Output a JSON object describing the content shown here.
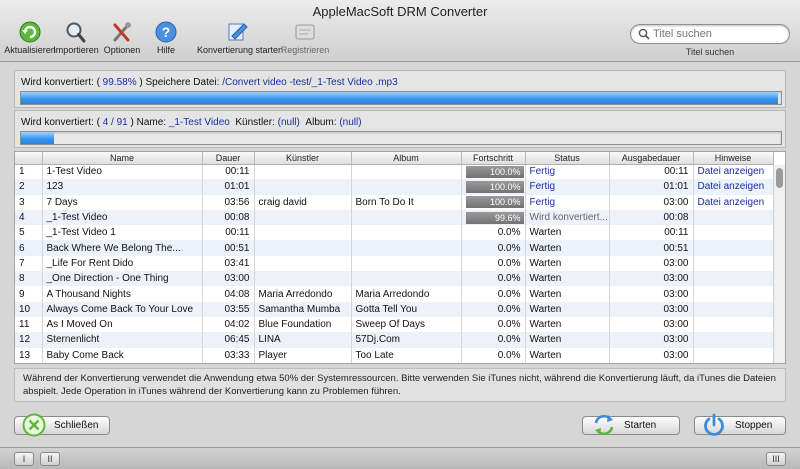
{
  "window": {
    "title": "AppleMacSoft DRM Converter"
  },
  "toolbar": {
    "items": [
      {
        "label": "Aktualisieren",
        "icon": "refresh-icon"
      },
      {
        "label": "Importieren",
        "icon": "magnifier-icon"
      },
      {
        "label": "Optionen",
        "icon": "tools-icon"
      },
      {
        "label": "Hilfe",
        "icon": "help-icon"
      },
      {
        "label": "Konvertierung starten",
        "icon": "convert-icon"
      },
      {
        "label": "Registrieren",
        "icon": "register-icon"
      }
    ],
    "search": {
      "placeholder": "Titel suchen",
      "label": "Titel suchen"
    }
  },
  "progress_file": {
    "prefix": "Wird konvertiert: (",
    "percent_text": " 99.58% ",
    "middle": ") Speichere Datei: ",
    "path": "/Convert video -test/_1-Test Video .mp3",
    "fill": 0.9958
  },
  "progress_total": {
    "prefix": "Wird konvertiert: ( ",
    "count_text": "4 / 91",
    "after_count": " ) Name: ",
    "name": "_1-Test Video",
    "artist_label": "Künstler: ",
    "artist": "(null)",
    "album_label": "Album: ",
    "album": "(null)",
    "fill": 0.044
  },
  "table": {
    "columns": [
      "Name",
      "Dauer",
      "Künstler",
      "Album",
      "Fortschritt",
      "Status",
      "Ausgabedauer",
      "Hinweise"
    ],
    "rows": [
      {
        "num": "1",
        "name": "1-Test Video",
        "duration": "00:11",
        "artist": "",
        "album": "",
        "progress": "100.0%",
        "status": "Fertig",
        "output": "00:11",
        "note": "Datei anzeigen"
      },
      {
        "num": "2",
        "name": "123",
        "duration": "01:01",
        "artist": "",
        "album": "",
        "progress": "100.0%",
        "status": "Fertig",
        "output": "01:01",
        "note": "Datei anzeigen"
      },
      {
        "num": "3",
        "name": "7 Days",
        "duration": "03:56",
        "artist": "craig david",
        "album": "Born To Do It",
        "progress": "100.0%",
        "status": "Fertig",
        "output": "03:00",
        "note": "Datei anzeigen"
      },
      {
        "num": "4",
        "name": "_1-Test Video",
        "duration": "00:08",
        "artist": "",
        "album": "",
        "progress": "99.6%",
        "status": "Wird konvertiert...",
        "output": "00:08",
        "note": ""
      },
      {
        "num": "5",
        "name": "_1-Test Video 1",
        "duration": "00:11",
        "artist": "",
        "album": "",
        "progress": "0.0%",
        "status": "Warten",
        "output": "00:11",
        "note": ""
      },
      {
        "num": "6",
        "name": "Back Where We Belong The...",
        "duration": "00:51",
        "artist": "",
        "album": "",
        "progress": "0.0%",
        "status": "Warten",
        "output": "00:51",
        "note": ""
      },
      {
        "num": "7",
        "name": "_Life For Rent Dido",
        "duration": "03:41",
        "artist": "",
        "album": "",
        "progress": "0.0%",
        "status": "Warten",
        "output": "03:00",
        "note": ""
      },
      {
        "num": "8",
        "name": "_One Direction - One Thing",
        "duration": "03:00",
        "artist": "",
        "album": "",
        "progress": "0.0%",
        "status": "Warten",
        "output": "03:00",
        "note": ""
      },
      {
        "num": "9",
        "name": "A Thousand Nights",
        "duration": "04:08",
        "artist": "Maria Arredondo",
        "album": "Maria Arredondo",
        "progress": "0.0%",
        "status": "Warten",
        "output": "03:00",
        "note": ""
      },
      {
        "num": "10",
        "name": "Always Come Back To Your Love",
        "duration": "03:55",
        "artist": "Samantha Mumba",
        "album": "Gotta Tell You",
        "progress": "0.0%",
        "status": "Warten",
        "output": "03:00",
        "note": ""
      },
      {
        "num": "11",
        "name": "As I Moved On",
        "duration": "04:02",
        "artist": "Blue Foundation",
        "album": "Sweep Of Days",
        "progress": "0.0%",
        "status": "Warten",
        "output": "03:00",
        "note": ""
      },
      {
        "num": "12",
        "name": "Sternenlicht",
        "duration": "06:45",
        "artist": "LINA",
        "album": "57Dj.Com",
        "progress": "0.0%",
        "status": "Warten",
        "output": "03:00",
        "note": ""
      },
      {
        "num": "13",
        "name": "Baby Come Back",
        "duration": "03:33",
        "artist": "Player",
        "album": "Too Late",
        "progress": "0.0%",
        "status": "Warten",
        "output": "03:00",
        "note": ""
      }
    ]
  },
  "info_text": "Während der Konvertierung verwendet die Anwendung etwa 50% der Systemressourcen. Bitte verwenden Sie iTunes nicht, während die Konvertierung läuft, da iTunes die Dateien abspielt.  Jede Operation in iTunes während der Konvertierung kann zu Problemen führen.",
  "buttons": {
    "close": {
      "label": "Schließen",
      "icon": "close-circle-icon"
    },
    "start": {
      "label": "Starten",
      "icon": "sync-arrows-icon"
    },
    "stop": {
      "label": "Stoppen",
      "icon": "power-icon"
    }
  },
  "statusbar": {
    "left1": "I",
    "left2": "II",
    "right": "III"
  },
  "colors": {
    "accent": "#3b96ef",
    "link": "#1a2da0"
  }
}
